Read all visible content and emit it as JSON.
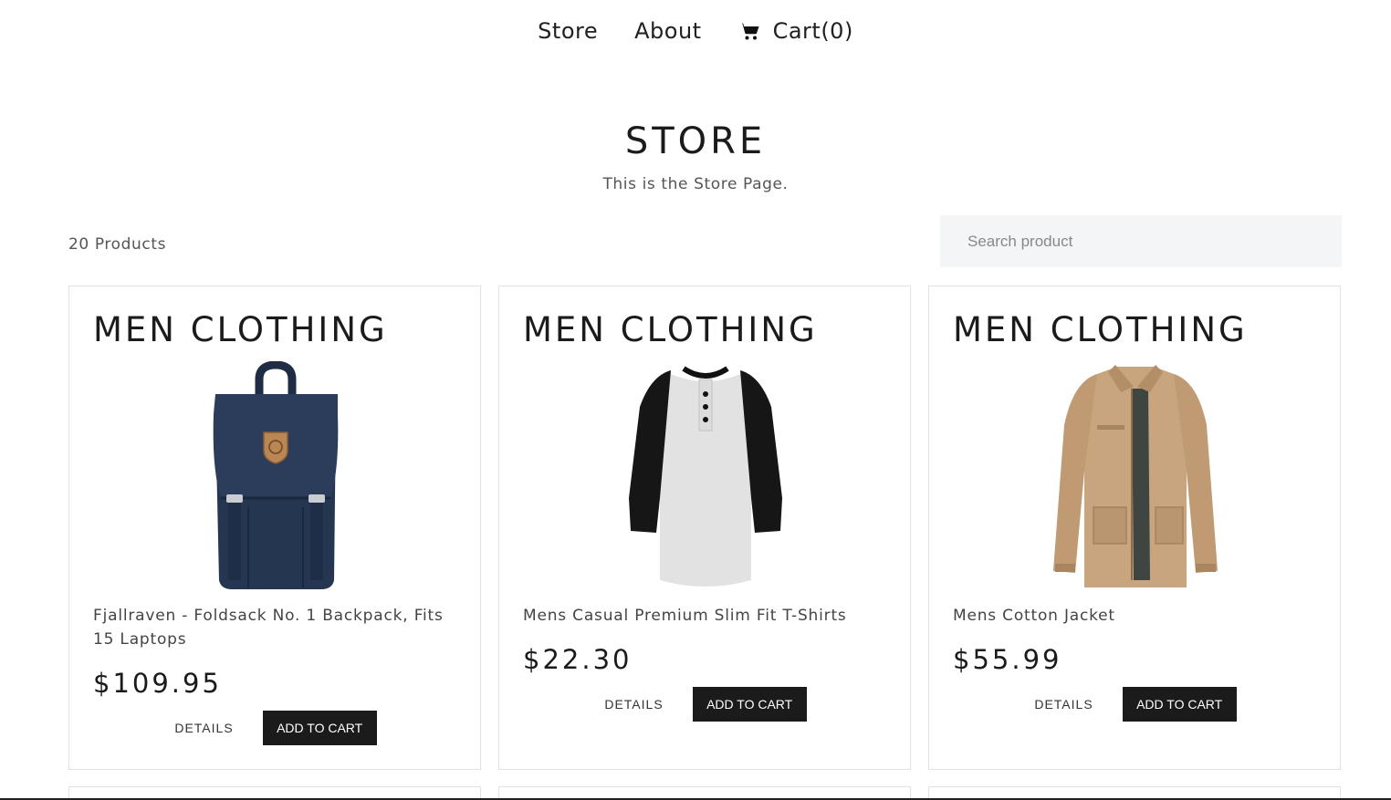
{
  "nav": {
    "store": "Store",
    "about": "About",
    "cart": "Cart(0)",
    "cart_icon": "shopping-cart-icon"
  },
  "header": {
    "title": "STORE",
    "subtitle": "This is the Store Page."
  },
  "toolbar": {
    "count": "20 Products",
    "search_placeholder": "Search product"
  },
  "products": [
    {
      "category": "MEN CLOTHING",
      "image": "backpack-image",
      "title": "Fjallraven - Foldsack No. 1 Backpack, Fits 15 Laptops",
      "price": "$109.95",
      "details_label": "DETAILS",
      "add_label": "ADD TO CART"
    },
    {
      "category": "MEN CLOTHING",
      "image": "raglan-tshirt-image",
      "title": "Mens Casual Premium Slim Fit T-Shirts",
      "price": "$22.30",
      "details_label": "DETAILS",
      "add_label": "ADD TO CART"
    },
    {
      "category": "MEN CLOTHING",
      "image": "cotton-jacket-image",
      "title": "Mens Cotton Jacket",
      "price": "$55.99",
      "details_label": "DETAILS",
      "add_label": "ADD TO CART"
    }
  ],
  "colors": {
    "text": "#212121",
    "button_bg": "#1b1b1b",
    "search_bg": "#f4f5f7",
    "card_border": "#e2e2e2"
  }
}
